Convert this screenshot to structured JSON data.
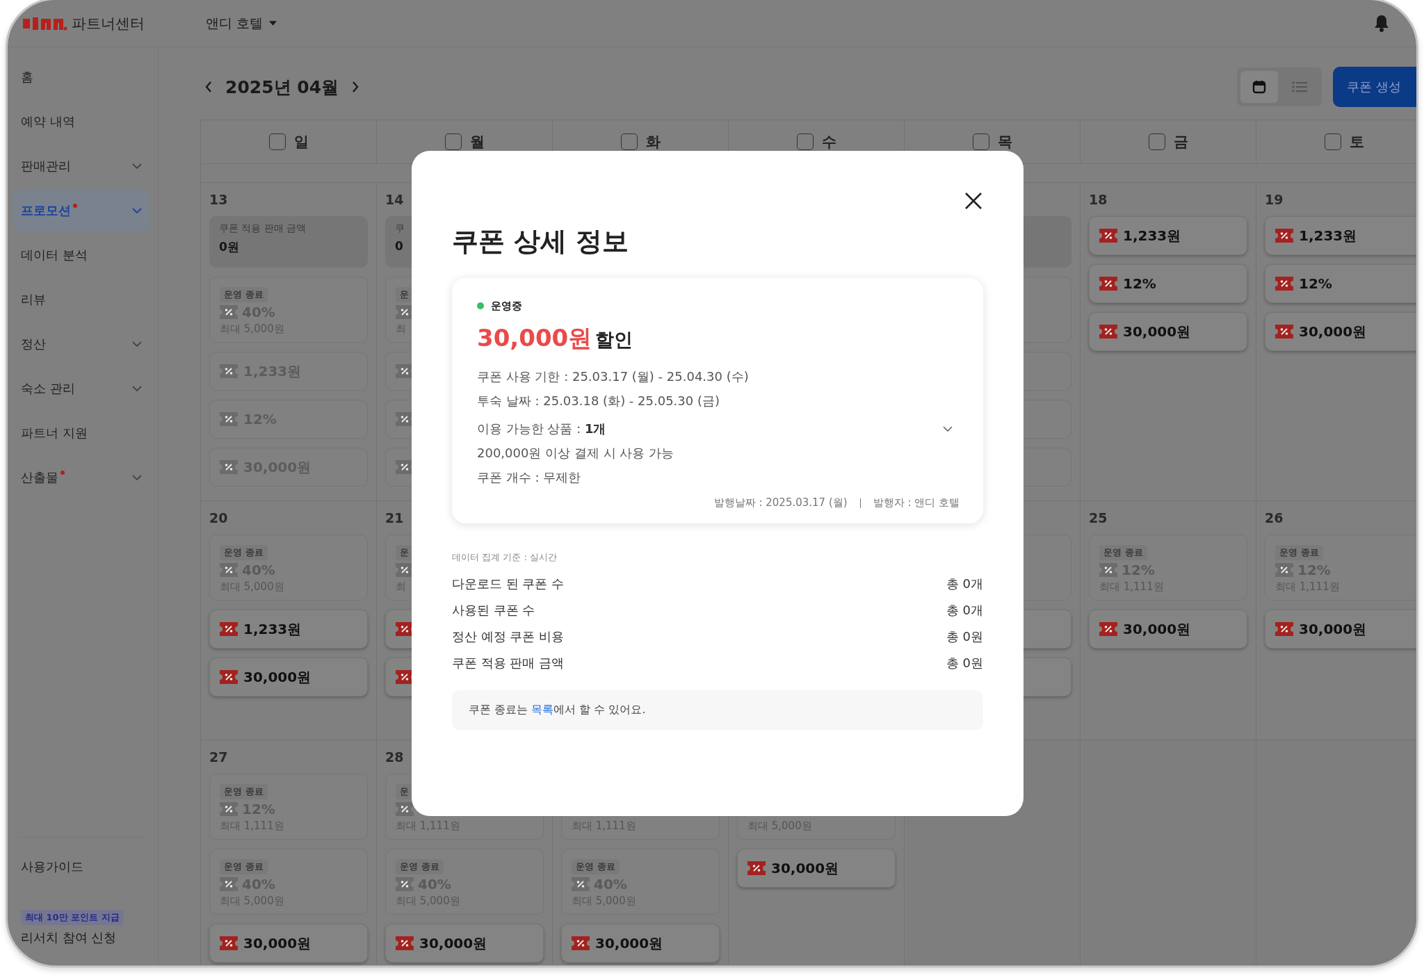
{
  "header": {
    "brand": "파트너센터",
    "property": "앤디 호텔"
  },
  "sidebar": {
    "items": [
      {
        "label": "홈",
        "selected": false,
        "submenu": false,
        "dot": false
      },
      {
        "label": "예약 내역",
        "selected": false,
        "submenu": false,
        "dot": false
      },
      {
        "label": "판매관리",
        "selected": false,
        "submenu": true,
        "dot": false
      },
      {
        "label": "프로모션",
        "selected": true,
        "submenu": true,
        "dot": true
      },
      {
        "label": "데이터 분석",
        "selected": false,
        "submenu": false,
        "dot": false
      },
      {
        "label": "리뷰",
        "selected": false,
        "submenu": false,
        "dot": false
      },
      {
        "label": "정산",
        "selected": false,
        "submenu": true,
        "dot": false
      },
      {
        "label": "숙소 관리",
        "selected": false,
        "submenu": true,
        "dot": false
      },
      {
        "label": "파트너 지원",
        "selected": false,
        "submenu": false,
        "dot": false
      },
      {
        "label": "산출물",
        "selected": false,
        "submenu": true,
        "dot": true
      }
    ],
    "guide": "사용가이드",
    "research": {
      "badge": "최대 10만 포인트 지급",
      "label": "리서치 참여 신청"
    }
  },
  "calendar": {
    "month": "2025년 04월",
    "create_button": "쿠폰 생성",
    "views": [
      {
        "kind": "calendar",
        "selected": true
      },
      {
        "kind": "list",
        "selected": false
      }
    ],
    "weekdays": [
      {
        "label": "일",
        "checked": false
      },
      {
        "label": "월",
        "checked": false
      },
      {
        "label": "화",
        "checked": false
      },
      {
        "label": "수",
        "checked": false
      },
      {
        "label": "목",
        "checked": false
      },
      {
        "label": "금",
        "checked": false
      },
      {
        "label": "토",
        "checked": false
      }
    ],
    "weeks": [
      [
        {
          "date": "13",
          "coupons": [
            {
              "kind": "summary",
              "label": "쿠폰 적용 판매 금액",
              "value": "0원"
            },
            {
              "kind": "ended",
              "badge": "운영 종료",
              "value": "40%",
              "limit": "최대 5,000원"
            },
            {
              "kind": "inactive",
              "value": "1,233원"
            },
            {
              "kind": "inactive",
              "value": "12%"
            },
            {
              "kind": "inactive",
              "value": "30,000원"
            }
          ]
        },
        {
          "date": "14",
          "coupons": [
            {
              "kind": "summary",
              "label": "쿠",
              "value": "0"
            },
            {
              "kind": "ended",
              "badge": "운",
              "limit": "최",
              "icon": true
            },
            {
              "kind": "inactive",
              "icon": true
            },
            {
              "kind": "inactive",
              "icon": true
            },
            {
              "kind": "inactive",
              "icon": true
            }
          ]
        },
        {
          "kind": "blank"
        },
        {
          "kind": "blank"
        },
        {
          "coupons": [
            {
              "kind": "summary"
            },
            {
              "kind": "ended"
            },
            {
              "kind": "inactive"
            },
            {
              "kind": "inactive"
            },
            {
              "kind": "inactive"
            }
          ]
        },
        {
          "date": "18",
          "coupons": [
            {
              "kind": "active",
              "value": "1,233원"
            },
            {
              "kind": "active",
              "value": "12%"
            },
            {
              "kind": "active",
              "value": "30,000원"
            }
          ]
        },
        {
          "date": "19",
          "coupons": [
            {
              "kind": "active",
              "value": "1,233원"
            },
            {
              "kind": "active",
              "value": "12%"
            },
            {
              "kind": "active",
              "value": "30,000원"
            }
          ]
        }
      ],
      [
        {
          "date": "20",
          "coupons": [
            {
              "kind": "ended",
              "badge": "운영 종료",
              "value": "40%",
              "limit": "최대 5,000원"
            },
            {
              "kind": "active",
              "value": "1,233원"
            },
            {
              "kind": "active",
              "value": "30,000원"
            }
          ]
        },
        {
          "date": "21",
          "coupons": [
            {
              "kind": "ended",
              "badge": "운",
              "limit": "최",
              "icon": true
            },
            {
              "kind": "active",
              "icon": true
            },
            {
              "kind": "active",
              "icon": true
            }
          ]
        },
        {
          "kind": "blank"
        },
        {
          "kind": "blank"
        },
        {
          "coupons": [
            {
              "kind": "ended"
            },
            {
              "kind": "active"
            },
            {
              "kind": "active"
            }
          ]
        },
        {
          "date": "25",
          "coupons": [
            {
              "kind": "ended",
              "badge": "운영 종료",
              "value": "12%",
              "limit": "최대 1,111원"
            },
            {
              "kind": "active",
              "value": "30,000원"
            }
          ]
        },
        {
          "date": "26",
          "coupons": [
            {
              "kind": "ended",
              "badge": "운영 종료",
              "value": "12%",
              "limit": "최대 1,111원"
            },
            {
              "kind": "active",
              "value": "30,000원"
            }
          ]
        }
      ],
      [
        {
          "date": "27",
          "coupons": [
            {
              "kind": "ended",
              "badge": "운영 종료",
              "value": "12%",
              "limit": "최대 1,111원"
            },
            {
              "kind": "ended",
              "badge": "운영 종료",
              "value": "40%",
              "limit": "최대 5,000원"
            },
            {
              "kind": "active",
              "value": "30,000원"
            }
          ]
        },
        {
          "date": "28",
          "coupons": [
            {
              "kind": "ended",
              "badge": "운",
              "limit": "최대 1,111원",
              "icon": true
            },
            {
              "kind": "ended",
              "badge": "운영 종료",
              "value": "40%",
              "limit": "최대 5,000원"
            },
            {
              "kind": "active",
              "value": "30,000원"
            }
          ]
        },
        {
          "coupons": [
            {
              "kind": "ended",
              "limit": "최대 1,111원"
            },
            {
              "kind": "ended",
              "badge": "운영 종료",
              "value": "40%",
              "limit": "최대 5,000원"
            },
            {
              "kind": "active",
              "value": "30,000원"
            }
          ]
        },
        {
          "coupons": [
            {
              "kind": "ended",
              "limit": "최대 5,000원"
            },
            {
              "kind": "active",
              "value": "30,000원"
            }
          ]
        },
        {
          "kind": "blank"
        },
        {
          "kind": "blank"
        },
        {
          "kind": "blank"
        }
      ]
    ]
  },
  "modal": {
    "title": "쿠폰 상세 정보",
    "status": "운영중",
    "amount": "30,000원",
    "amount_suffix": "할인",
    "details": [
      {
        "kind": "text",
        "text": "쿠폰 사용 기한 : 25.03.17 (월) - 25.04.30 (수)"
      },
      {
        "kind": "text",
        "text": "투숙 날짜 : 25.03.18 (화) - 25.05.30 (금)"
      },
      {
        "kind": "expandable",
        "text": "이용 가능한 상품 : **1개**"
      },
      {
        "kind": "text",
        "text": "200,000원 이상 결제 시 사용 가능"
      },
      {
        "kind": "text",
        "text": "쿠폰 개수 : 무제한"
      }
    ],
    "issued": "발행날짜 : 2025.03.17 (월)",
    "issuer": "발행자 : 앤디 호텔",
    "basis": "데이터 집계 기준 : 실시간",
    "stats": [
      {
        "label": "다운로드 된 쿠폰 수",
        "value": "총 0개"
      },
      {
        "label": "사용된 쿠폰 수",
        "value": "총 0개"
      },
      {
        "label": "정산 예정 쿠폰 비용",
        "value": "총 0원"
      },
      {
        "label": "쿠폰 적용 판매 금액",
        "value": "총 0원"
      }
    ],
    "notice": {
      "before": "쿠폰 종료는 ",
      "link": "목록",
      "after": "에서 할 수 있어요."
    }
  }
}
